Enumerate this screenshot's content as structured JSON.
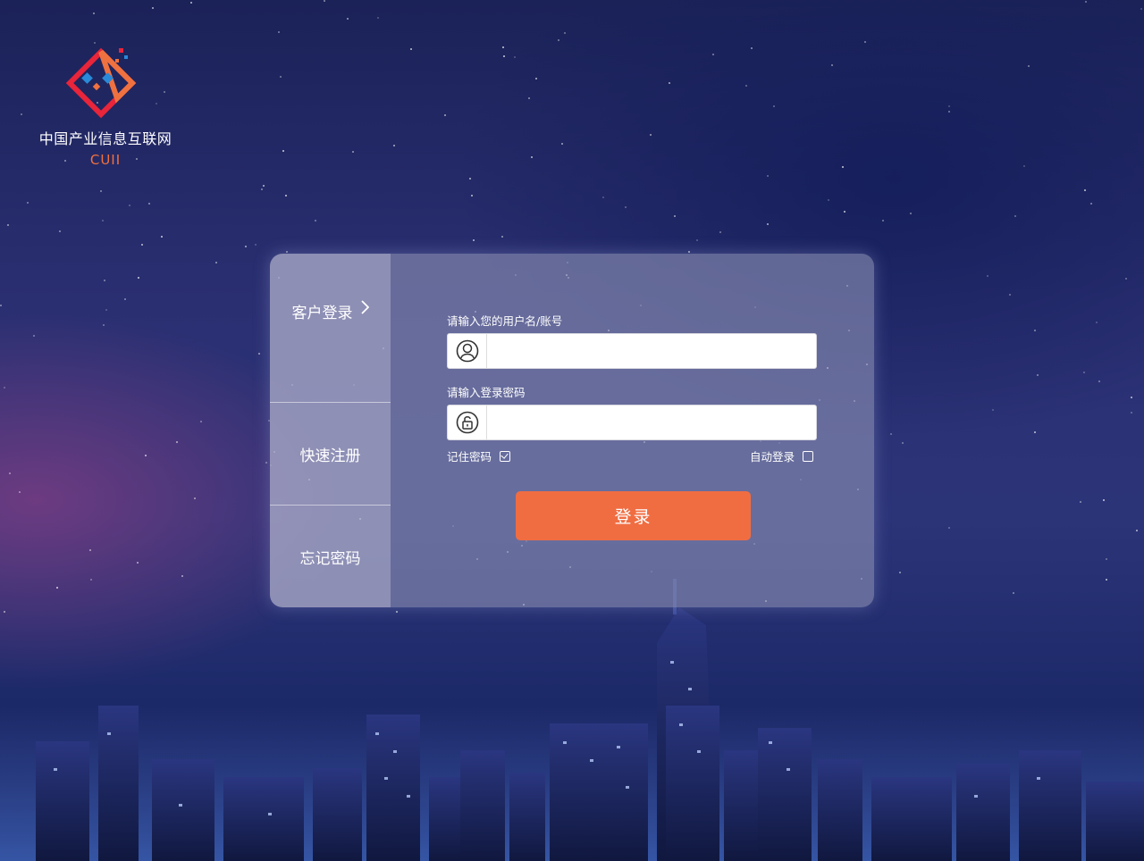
{
  "logo": {
    "name": "中国产业信息互联网",
    "abbr": "CUII",
    "accent_color": "#f07140",
    "secondary_color": "#e8253a",
    "dot_color": "#2a8ad8"
  },
  "tabs": [
    {
      "label": "客户登录",
      "active": true
    },
    {
      "label": "快速注册",
      "active": false
    },
    {
      "label": "忘记密码",
      "active": false
    }
  ],
  "form": {
    "username_label": "请输入您的用户名/账号",
    "username_value": "",
    "username_icon": "user-icon",
    "password_label": "请输入登录密码",
    "password_value": "",
    "password_icon": "lock-icon",
    "remember_label": "记住密码",
    "remember_checked": true,
    "auto_login_label": "自动登录",
    "auto_login_checked": false,
    "submit_label": "登录",
    "submit_color": "#f06d42"
  }
}
